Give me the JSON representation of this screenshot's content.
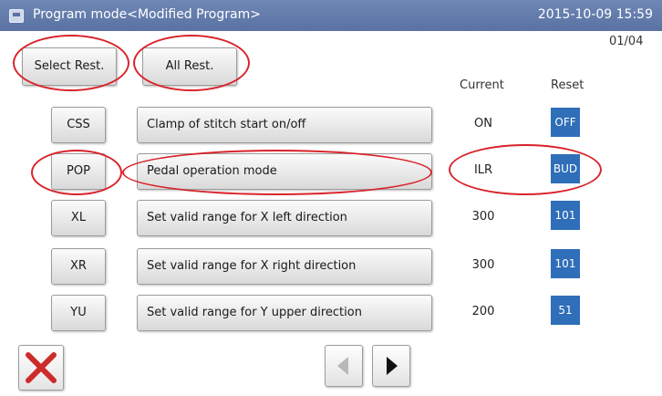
{
  "titlebar": {
    "icon": "window-icon",
    "title": "Program mode<Modified Program>",
    "datetime": "2015-10-09 15:59"
  },
  "toolbar": {
    "select_rest_label": "Select Rest.",
    "all_rest_label": "All Rest."
  },
  "page_indicator": "01/04",
  "columns": {
    "current": "Current",
    "reset": "Reset"
  },
  "rows": [
    {
      "code": "CSS",
      "description": "Clamp of stitch start on/off",
      "current": "ON",
      "reset": "OFF"
    },
    {
      "code": "POP",
      "description": "Pedal operation mode",
      "current": "ILR",
      "reset": "BUD"
    },
    {
      "code": "XL",
      "description": "Set valid range for X left direction",
      "current": "300",
      "reset": "101"
    },
    {
      "code": "XR",
      "description": "Set valid range for X right direction",
      "current": "300",
      "reset": "101"
    },
    {
      "code": "YU",
      "description": "Set valid range for Y upper direction",
      "current": "200",
      "reset": "51"
    }
  ],
  "footer": {
    "close_icon": "close-x-icon",
    "prev_icon": "triangle-left-icon",
    "next_icon": "triangle-right-icon"
  },
  "colors": {
    "titlebar": "#5f77a8",
    "reset_box": "#2f6eb8",
    "annotation": "#d9232a",
    "close_icon": "#cc2b2b"
  }
}
